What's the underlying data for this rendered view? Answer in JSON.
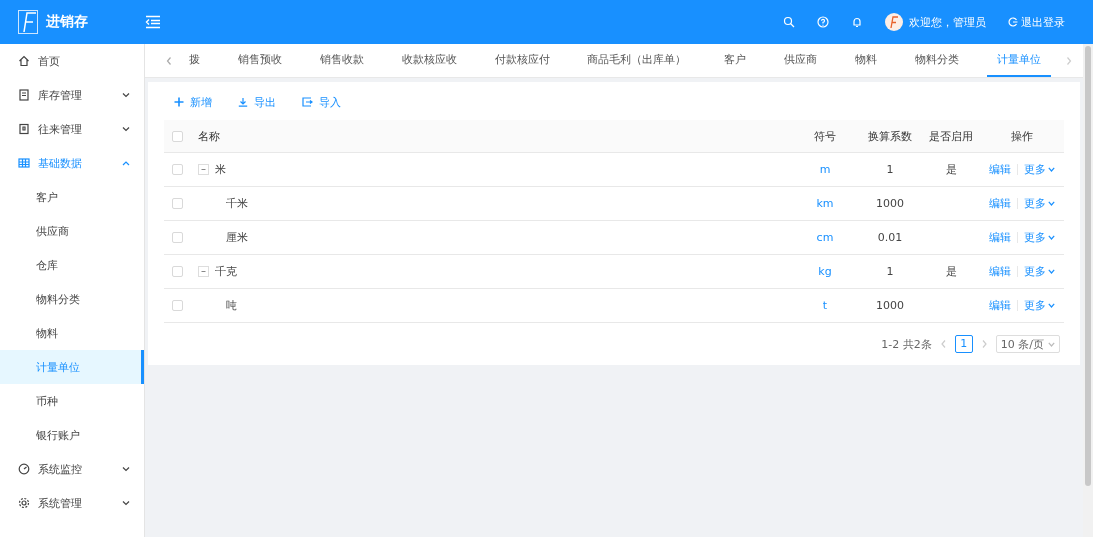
{
  "header": {
    "app_title": "进销存",
    "welcome": "欢迎您，管理员",
    "logout": "退出登录"
  },
  "sidebar": {
    "items": [
      {
        "label": "首页"
      },
      {
        "label": "库存管理",
        "expanded": false
      },
      {
        "label": "往来管理",
        "expanded": false
      },
      {
        "label": "基础数据",
        "expanded": true,
        "children": [
          {
            "label": "客户",
            "selected": false
          },
          {
            "label": "供应商",
            "selected": false
          },
          {
            "label": "仓库",
            "selected": false
          },
          {
            "label": "物料分类",
            "selected": false
          },
          {
            "label": "物料",
            "selected": false
          },
          {
            "label": "计量单位",
            "selected": true
          },
          {
            "label": "币种",
            "selected": false
          },
          {
            "label": "银行账户",
            "selected": false
          }
        ]
      },
      {
        "label": "系统监控",
        "expanded": false
      },
      {
        "label": "系统管理",
        "expanded": false
      }
    ]
  },
  "tabs": [
    {
      "label": "拨",
      "selected": false
    },
    {
      "label": "销售预收",
      "selected": false
    },
    {
      "label": "销售收款",
      "selected": false
    },
    {
      "label": "收款核应收",
      "selected": false
    },
    {
      "label": "付款核应付",
      "selected": false
    },
    {
      "label": "商品毛利（出库单）",
      "selected": false
    },
    {
      "label": "客户",
      "selected": false
    },
    {
      "label": "供应商",
      "selected": false
    },
    {
      "label": "物料",
      "selected": false
    },
    {
      "label": "物料分类",
      "selected": false
    },
    {
      "label": "计量单位",
      "selected": true
    }
  ],
  "toolbar": [
    "新增",
    "导出",
    "导入"
  ],
  "table": {
    "columns": [
      "名称",
      "符号",
      "换算系数",
      "是否启用",
      "操作"
    ],
    "header_checked": false,
    "rows": [
      {
        "name": "米",
        "symbol": "m",
        "factor": "1",
        "enabled": "是",
        "checked": false,
        "expanded": true,
        "actions": [
          "编辑",
          "更多"
        ],
        "children": [
          {
            "name": "千米",
            "symbol": "km",
            "factor": "1000",
            "checked": false,
            "actions": [
              "编辑",
              "更多"
            ]
          },
          {
            "name": "厘米",
            "symbol": "cm",
            "factor": "0.01",
            "checked": false,
            "actions": [
              "编辑",
              "更多"
            ]
          }
        ]
      },
      {
        "name": "千克",
        "symbol": "kg",
        "factor": "1",
        "enabled": "是",
        "checked": false,
        "expanded": true,
        "actions": [
          "编辑",
          "更多"
        ],
        "children": [
          {
            "name": "吨",
            "symbol": "t",
            "factor": "1000",
            "checked": false,
            "actions": [
              "编辑",
              "更多"
            ]
          }
        ]
      }
    ]
  },
  "pagination": {
    "total": "1-2 共2条",
    "pages": [
      {
        "label": "1",
        "selected": true
      }
    ],
    "page_size": "10 条/页"
  }
}
